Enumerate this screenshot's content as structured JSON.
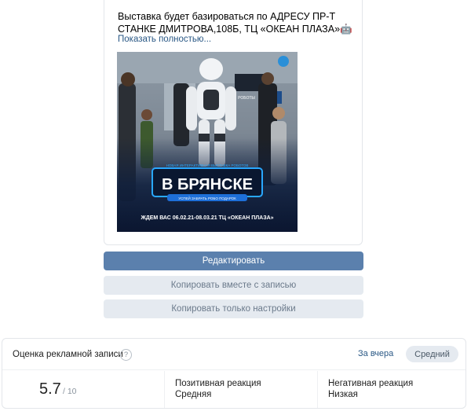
{
  "post": {
    "text": "Выставка будет базироваться по АДРЕСУ ПР-Т СТАНКЕ ДМИТРОВА,108Б, ТЦ «ОКЕАН ПЛАЗА»🤖",
    "show_more": "Показать полностью...",
    "image": {
      "brand_label": "РОБОТЫ",
      "subtitle": "НОВАЯ ИНТЕРАКТИВНАЯ ВЫСТАВКА РОБОТОВ",
      "headline": "В БРЯНСКЕ",
      "tagline": "УСПЕЙ ЗАБРАТЬ РОБО ПОДАРОК",
      "date_line": "ЖДЕМ ВАС 06.02.21-08.03.21 ТЦ «ОКЕАН ПЛАЗА»"
    }
  },
  "actions": {
    "edit": "Редактировать",
    "copy_with_post": "Копировать вместе с записью",
    "copy_settings": "Копировать только настройки"
  },
  "rating": {
    "title": "Оценка рекламной записи",
    "help": "?",
    "period": "За вчера",
    "level": "Средний",
    "score": "5.7",
    "score_max": "/ 10",
    "positive_label": "Позитивная реакция",
    "positive_value": "Средняя",
    "negative_label": "Негативная реакция",
    "negative_value": "Низкая"
  }
}
